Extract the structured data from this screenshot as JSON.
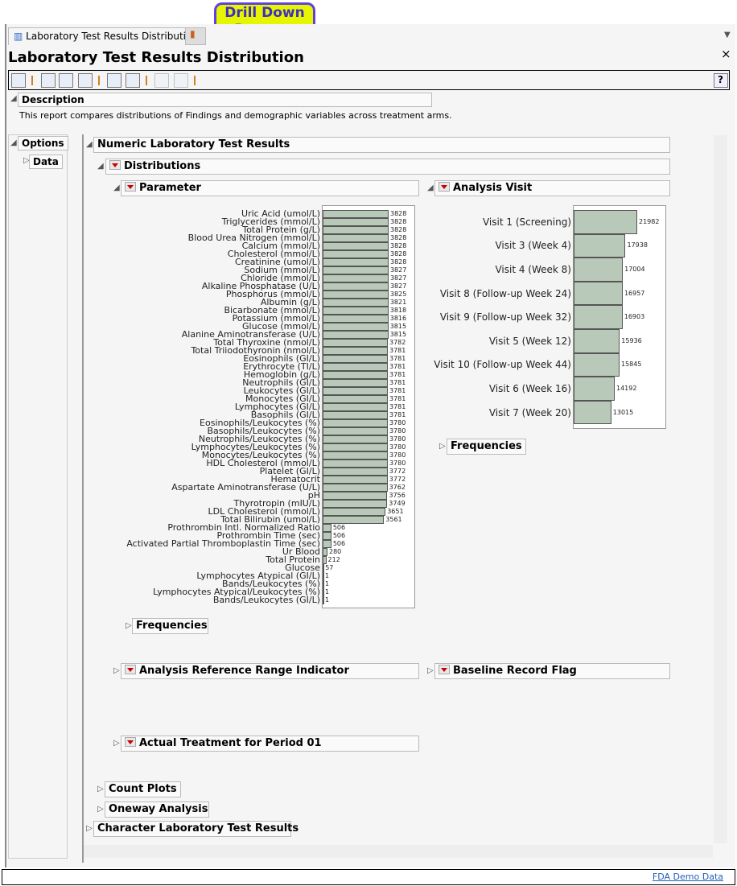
{
  "tab": {
    "label": "Laboratory Test Results Distribution"
  },
  "title": "Laboratory Test Results Distribution",
  "callout": "Drill Down Buttons",
  "help": "?",
  "close": "×",
  "description": {
    "header": "Description",
    "text": "This report compares distributions of Findings and demographic variables across treatment arms."
  },
  "options": {
    "header": "Options",
    "data": "Data"
  },
  "sections": {
    "numeric": "Numeric Laboratory Test Results",
    "distributions": "Distributions",
    "parameter": "Parameter",
    "analysis_visit": "Analysis Visit",
    "frequencies": "Frequencies",
    "frequencies2": "Frequencies",
    "arri": "Analysis Reference Range Indicator",
    "baseline": "Baseline Record Flag",
    "treatment": "Actual Treatment for Period 01",
    "count_plots": "Count Plots",
    "oneway": "Oneway Analysis",
    "character": "Character Laboratory Test Results"
  },
  "status": {
    "link": "FDA Demo Data"
  },
  "chart_data": [
    {
      "type": "bar",
      "title": "Parameter",
      "orientation": "horizontal",
      "xlim": [
        0,
        3828
      ],
      "categories": [
        "Uric Acid (umol/L)",
        "Triglycerides (mmol/L)",
        "Total Protein (g/L)",
        "Blood Urea Nitrogen (mmol/L)",
        "Calcium (mmol/L)",
        "Cholesterol (mmol/L)",
        "Creatinine (umol/L)",
        "Sodium (mmol/L)",
        "Chloride (mmol/L)",
        "Alkaline Phosphatase (U/L)",
        "Phosphorus (mmol/L)",
        "Albumin (g/L)",
        "Bicarbonate (mmol/L)",
        "Potassium (mmol/L)",
        "Glucose (mmol/L)",
        "Alanine Aminotransferase (U/L)",
        "Total Thyroxine (nmol/L)",
        "Total Triiodothyronin (nmol/L)",
        "Eosinophils (GI/L)",
        "Erythrocyte (TI/L)",
        "Hemoglobin (g/L)",
        "Neutrophils (GI/L)",
        "Leukocytes (GI/L)",
        "Monocytes (GI/L)",
        "Lymphocytes (GI/L)",
        "Basophils (GI/L)",
        "Eosinophils/Leukocytes (%)",
        "Basophils/Leukocytes (%)",
        "Neutrophils/Leukocytes (%)",
        "Lymphocytes/Leukocytes (%)",
        "Monocytes/Leukocytes (%)",
        "HDL Cholesterol (mmol/L)",
        "Platelet (GI/L)",
        "Hematocrit",
        "Aspartate Aminotransferase (U/L)",
        "pH",
        "Thyrotropin (mIU/L)",
        "LDL Cholesterol (mmol/L)",
        "Total Bilirubin (umol/L)",
        "Prothrombin Intl. Normalized Ratio",
        "Prothrombin Time (sec)",
        "Activated Partial Thromboplastin Time (sec)",
        "Ur Blood",
        "Total Protein",
        "Glucose",
        "Lymphocytes Atypical (GI/L)",
        "Bands/Leukocytes (%)",
        "Lymphocytes Atypical/Leukocytes (%)",
        "Bands/Leukocytes (GI/L)"
      ],
      "values": [
        3828,
        3828,
        3828,
        3828,
        3828,
        3828,
        3828,
        3827,
        3827,
        3827,
        3825,
        3821,
        3818,
        3816,
        3815,
        3815,
        3782,
        3781,
        3781,
        3781,
        3781,
        3781,
        3781,
        3781,
        3781,
        3781,
        3780,
        3780,
        3780,
        3780,
        3780,
        3780,
        3772,
        3772,
        3762,
        3756,
        3749,
        3651,
        3561,
        506,
        506,
        506,
        280,
        212,
        57,
        1,
        1,
        1,
        1
      ]
    },
    {
      "type": "bar",
      "title": "Analysis Visit",
      "orientation": "horizontal",
      "xlim": [
        0,
        21982
      ],
      "categories": [
        "Visit 1 (Screening)",
        "Visit 3 (Week 4)",
        "Visit 4 (Week 8)",
        "Visit 8 (Follow-up Week 24)",
        "Visit 9 (Follow-up Week 32)",
        "Visit 5 (Week 12)",
        "Visit 10 (Follow-up Week 44)",
        "Visit 6 (Week 16)",
        "Visit 7 (Week 20)"
      ],
      "values": [
        21982,
        17938,
        17004,
        16957,
        16903,
        15936,
        15845,
        14192,
        13015
      ]
    }
  ]
}
